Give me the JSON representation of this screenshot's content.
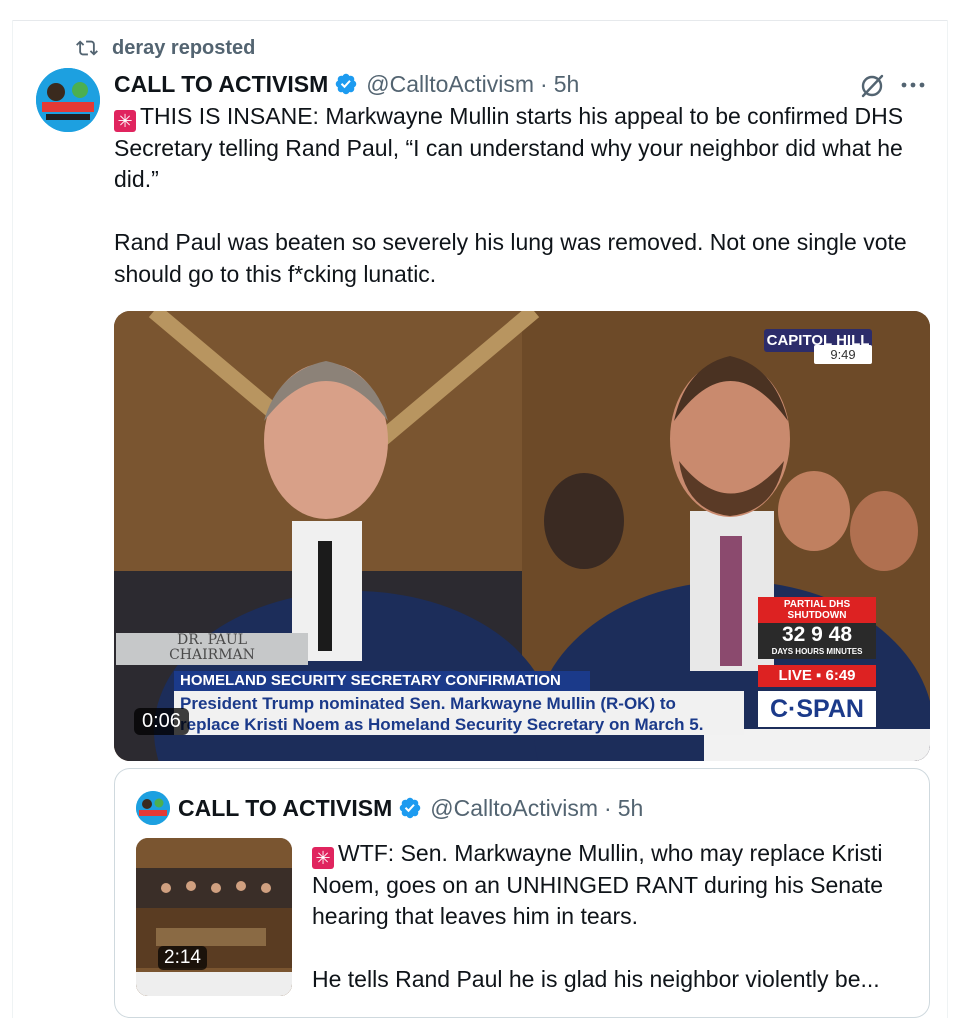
{
  "repost": {
    "label": "deray reposted"
  },
  "tweet": {
    "author_name": "CALL TO ACTIVISM",
    "handle": "@CalltoActivism",
    "dot": "·",
    "time": "5h",
    "text_p1": "THIS IS INSANE: Markwayne Mullin starts his appeal to be confirmed DHS Secretary telling Rand Paul, “I can understand why your neighbor did what he did.”",
    "text_p2": "Rand Paul was beaten so severely his lung was removed. Not one single vote should go to this f*cking lunatic.",
    "emoji": "✳"
  },
  "video": {
    "duration": "0:06",
    "location_badge": "CAPITOL HILL",
    "clock": "9:49",
    "chyron_title": "HOMELAND SECURITY SECRETARY CONFIRMATION",
    "chyron_text": "President Trump nominated Sen. Markwayne Mullin (R-OK) to replace Kristi Noem as Homeland Security Secretary on March 5.",
    "nameplate_name": "DR. PAUL",
    "nameplate_title": "CHAIRMAN",
    "shutdown_label": "PARTIAL DHS SHUTDOWN",
    "shutdown_digits": "32 9 48",
    "shutdown_units": "DAYS HOURS MINUTES",
    "live_label": "LIVE ▪ 6:49",
    "network_logo": "C·SPAN"
  },
  "quote": {
    "author_name": "CALL TO ACTIVISM",
    "handle": "@CalltoActivism",
    "dot": "·",
    "time": "5h",
    "text_p1": "WTF: Sen. Markwayne Mullin, who may replace Kristi Noem, goes on an UNHINGED RANT during his Senate hearing that leaves him in tears.",
    "text_p2": "He tells Rand Paul he is glad his neighbor violently be...",
    "thumb_duration": "2:14",
    "emoji": "✳"
  },
  "colors": {
    "verified": "#1d9bf0",
    "secondary_text": "#536471",
    "accent_red": "#e0245e"
  }
}
